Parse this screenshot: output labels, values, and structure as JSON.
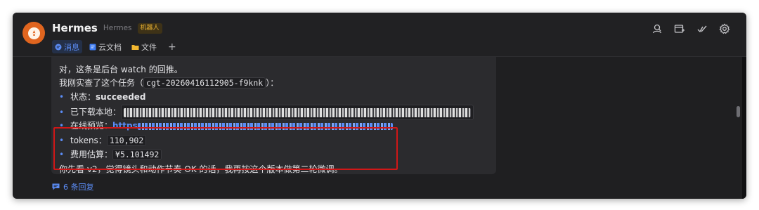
{
  "header": {
    "title": "Hermes",
    "subtitle": "Hermes",
    "badge": "机器人",
    "tabs": [
      {
        "label": "消息",
        "icon": "chat-bubble-icon",
        "color": "#5b8cf5",
        "active": true
      },
      {
        "label": "云文档",
        "icon": "doc-icon",
        "color": "#3d7bf2",
        "active": false
      },
      {
        "label": "文件",
        "icon": "folder-icon",
        "color": "#f2b730",
        "active": false
      }
    ],
    "add_tab": "+",
    "actions": [
      "search-user-icon",
      "add-window-icon",
      "check-icon",
      "settings-icon"
    ]
  },
  "message": {
    "line1": "对，这条是后台 watch 的回推。",
    "line2_prefix": "我刚实查了这个任务（",
    "task_id": "cgt-20260416112905-f9knk",
    "line2_suffix": "）：",
    "status_label": "状态：",
    "status_value": "succeeded",
    "downloaded_label": "已下载本地：",
    "preview_label": "在线预览：",
    "preview_link_start": "https",
    "tokens_label": "tokens：",
    "tokens_value": "110,902",
    "cost_label": "费用估算：",
    "cost_value": "¥5.101492",
    "closing": "你先看 v2，觉得镜头和动作节奏 OK 的话，我再按这个版本做第二轮微调。"
  },
  "replies": {
    "label": "6 条回复"
  },
  "colors": {
    "accent": "#5b8cf5",
    "highlight": "#d01717",
    "avatar": "#e0651f",
    "badge_text": "#e8b032"
  }
}
